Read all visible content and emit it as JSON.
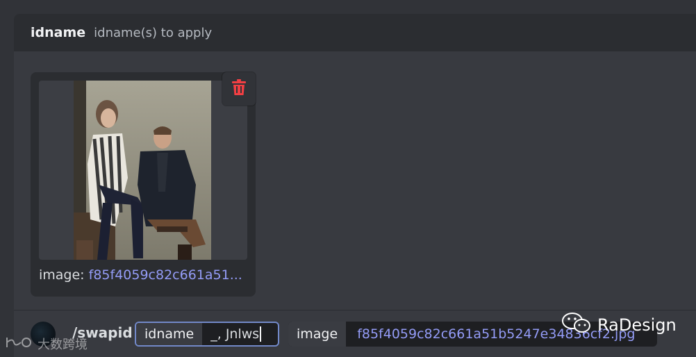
{
  "option": {
    "name": "idname",
    "description": "idname(s) to apply"
  },
  "attachment": {
    "image_alt": "photo of a woman in a striped dress and a man in a dark jacket",
    "caption_prefix": "image:",
    "caption_filename": "f85f4059c82c661a51..."
  },
  "command": {
    "slash": "/swapid",
    "idname_label": "idname",
    "idname_value": "_, Jnlws",
    "image_label": "image",
    "image_value": "f85f4059c82c661a51b5247e34836cf2.jpg"
  },
  "watermarks": {
    "left": "大数跨境",
    "right": "RaDesign"
  },
  "colors": {
    "background": "#313338",
    "panel": "#383a40",
    "link": "#949cf7",
    "danger": "#f23f43"
  }
}
